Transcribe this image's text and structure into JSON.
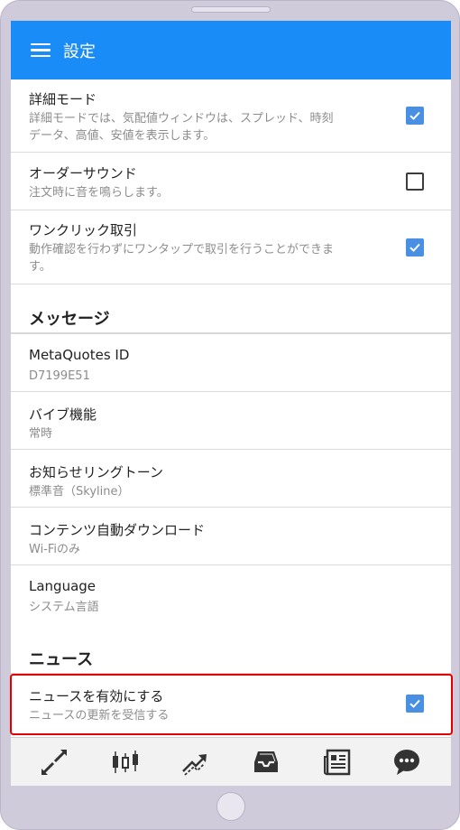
{
  "appbar": {
    "title": "設定"
  },
  "settings_top": [
    {
      "title": "詳細モード",
      "sub_lines": [
        "詳細モードでは、気配値ウィンドウは、スプレッド、時刻",
        "データ、高値、安値を表示します。"
      ],
      "checked": true
    },
    {
      "title": "オーダーサウンド",
      "sub_lines": [
        "注文時に音を鳴らします。"
      ],
      "checked": false
    },
    {
      "title": "ワンクリック取引",
      "sub_lines": [
        "動作確認を行わずにワンタップで取引を行うことができま",
        "す。"
      ],
      "checked": true
    }
  ],
  "messages_section": {
    "heading": "メッセージ",
    "items": [
      {
        "title": "MetaQuotes ID",
        "value": "D7199E51"
      },
      {
        "title": "バイブ機能",
        "value": "常時"
      },
      {
        "title": "お知らせリングトーン",
        "value": "標準音（Skyline）"
      },
      {
        "title": "コンテンツ自動ダウンロード",
        "value": "Wi-Fiのみ"
      },
      {
        "title": "Language",
        "value": "システム言語"
      }
    ]
  },
  "news_section": {
    "heading": "ニュース",
    "enable": {
      "title": "ニュースを有効にする",
      "sub": "ニュースの更新を受信する",
      "checked": true
    }
  },
  "tabbar": {
    "icons": [
      "quotes-icon",
      "chart-icon",
      "trade-icon",
      "history-icon",
      "news-icon",
      "chat-icon"
    ]
  },
  "colors": {
    "accent": "#1a8cf8",
    "checkbox": "#4a90e2",
    "highlight": "#e00000"
  }
}
